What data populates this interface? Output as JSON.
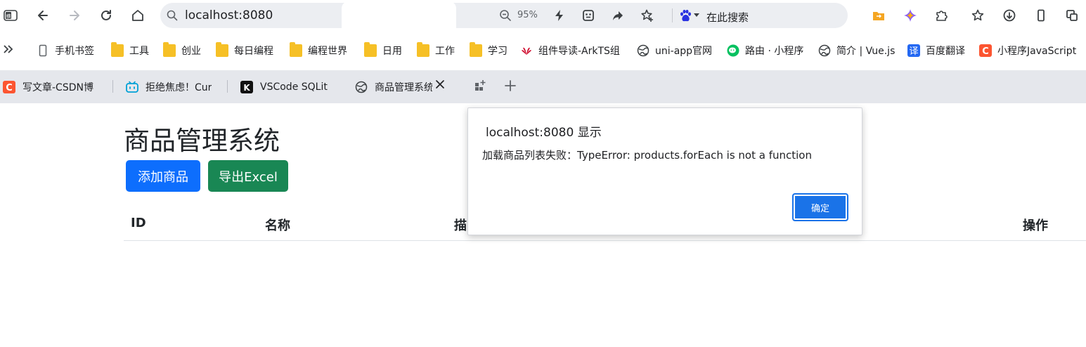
{
  "toolbar": {
    "url": "localhost:8080",
    "zoom": "95%",
    "search_engine_label": "在此搜索",
    "brand_color": "#1a73e8"
  },
  "bookmarks": [
    {
      "label": "手机书签",
      "icon": "phone-icon"
    },
    {
      "label": "工具",
      "icon": "folder-icon"
    },
    {
      "label": "创业",
      "icon": "folder-icon"
    },
    {
      "label": "每日编程",
      "icon": "folder-icon"
    },
    {
      "label": "编程世界",
      "icon": "folder-icon"
    },
    {
      "label": "日用",
      "icon": "folder-icon"
    },
    {
      "label": "工作",
      "icon": "folder-icon"
    },
    {
      "label": "学习",
      "icon": "folder-icon"
    },
    {
      "label": "组件导读-ArkTS组",
      "icon": "huawei-icon"
    },
    {
      "label": "uni-app官网",
      "icon": "globe-icon"
    },
    {
      "label": "路由 · 小程序",
      "icon": "wechat-icon"
    },
    {
      "label": "简介 | Vue.js",
      "icon": "globe-icon"
    },
    {
      "label": "百度翻译",
      "icon": "translate-icon"
    },
    {
      "label": "小程序JavaScript",
      "icon": "csdn-icon"
    }
  ],
  "tabs": [
    {
      "label": "写文章-CSDN博",
      "icon": "csdn-icon",
      "active": false
    },
    {
      "label": "拒绝焦虑！Cur",
      "icon": "bilibili-icon",
      "active": false
    },
    {
      "label": "VSCode SQLit",
      "icon": "k-app-icon",
      "active": false
    },
    {
      "label": "商品管理系统",
      "icon": "globe-icon",
      "active": true
    }
  ],
  "page": {
    "title": "商品管理系统",
    "add_button": "添加商品",
    "export_button": "导出Excel",
    "columns": [
      "ID",
      "名称",
      "描",
      "操作"
    ]
  },
  "dialog": {
    "title": "localhost:8080 显示",
    "message": "加载商品列表失败：TypeError: products.forEach is not a function",
    "ok_label": "确定"
  }
}
